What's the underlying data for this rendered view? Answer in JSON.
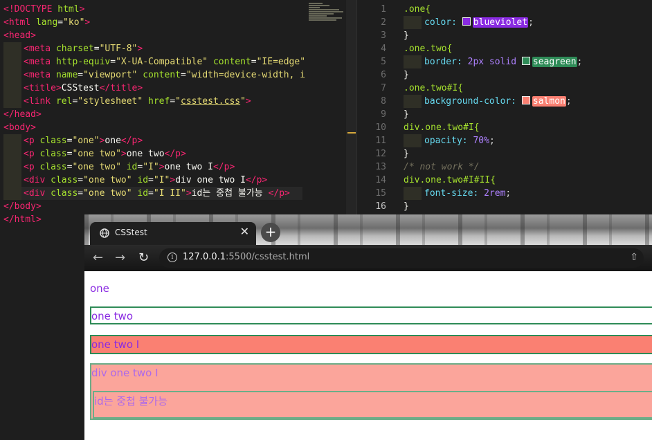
{
  "html_editor": {
    "lines": [
      "<!DOCTYPE html>",
      "<html lang=\"ko\">",
      "<head>",
      "<meta charset=\"UTF-8\">",
      "<meta http-equiv=\"X-UA-Compatible\" content=\"IE=edge\"",
      "<meta name=\"viewport\" content=\"width=device-width, i",
      "<title>CSStest</title>",
      "<link rel=\"stylesheet\" href=\"csstest.css\">",
      "</head>",
      "<body>",
      "<p class=\"one\">one</p>",
      "<p class=\"one two\">one two</p>",
      "<p class=\"one two\" id=\"I\">one two I</p>",
      "<div class=\"one two\" id=\"I\">div one two I</p>",
      "<div class=\"one two\" id=\"I II\">id는 중첩 불가능 </p>",
      "</body>",
      "</html>"
    ]
  },
  "css_editor": {
    "line_numbers": [
      "1",
      "2",
      "3",
      "4",
      "5",
      "6",
      "7",
      "8",
      "9",
      "10",
      "11",
      "12",
      "13",
      "14",
      "15",
      "16"
    ],
    "rules": {
      "r1_selector": ".one{",
      "r1_prop": "color:",
      "r1_value": "blueviolet",
      "r2_selector": ".one.two{",
      "r2_prop": "border:",
      "r2_value_pre": "2px solid",
      "r2_value": "seagreen",
      "r3_selector": ".one.two#I{",
      "r3_prop": "background-color:",
      "r3_value": "salmon",
      "r4_selector": "div.one.two#I{",
      "r4_prop": "opacity:",
      "r4_value": "70%",
      "comment": "/* not work */",
      "r5_selector": "div.one.two#I#II{",
      "r5_prop": "font-size:",
      "r5_value": "2rem",
      "close": "}"
    },
    "colors": {
      "blueviolet": "#8a2be2",
      "seagreen": "#2e8b57",
      "salmon": "#fa8072"
    }
  },
  "browser": {
    "tab_title": "CSStest",
    "close_glyph": "✕",
    "new_tab_glyph": "+",
    "url_host": "127.0.0.1",
    "url_path": ":5500/csstest.html",
    "info_glyph": "i"
  },
  "page": {
    "p1": "one",
    "p2": "one two",
    "p3": "one two I",
    "div1": "div one two I",
    "div2": "id는 중첩 불가능"
  }
}
